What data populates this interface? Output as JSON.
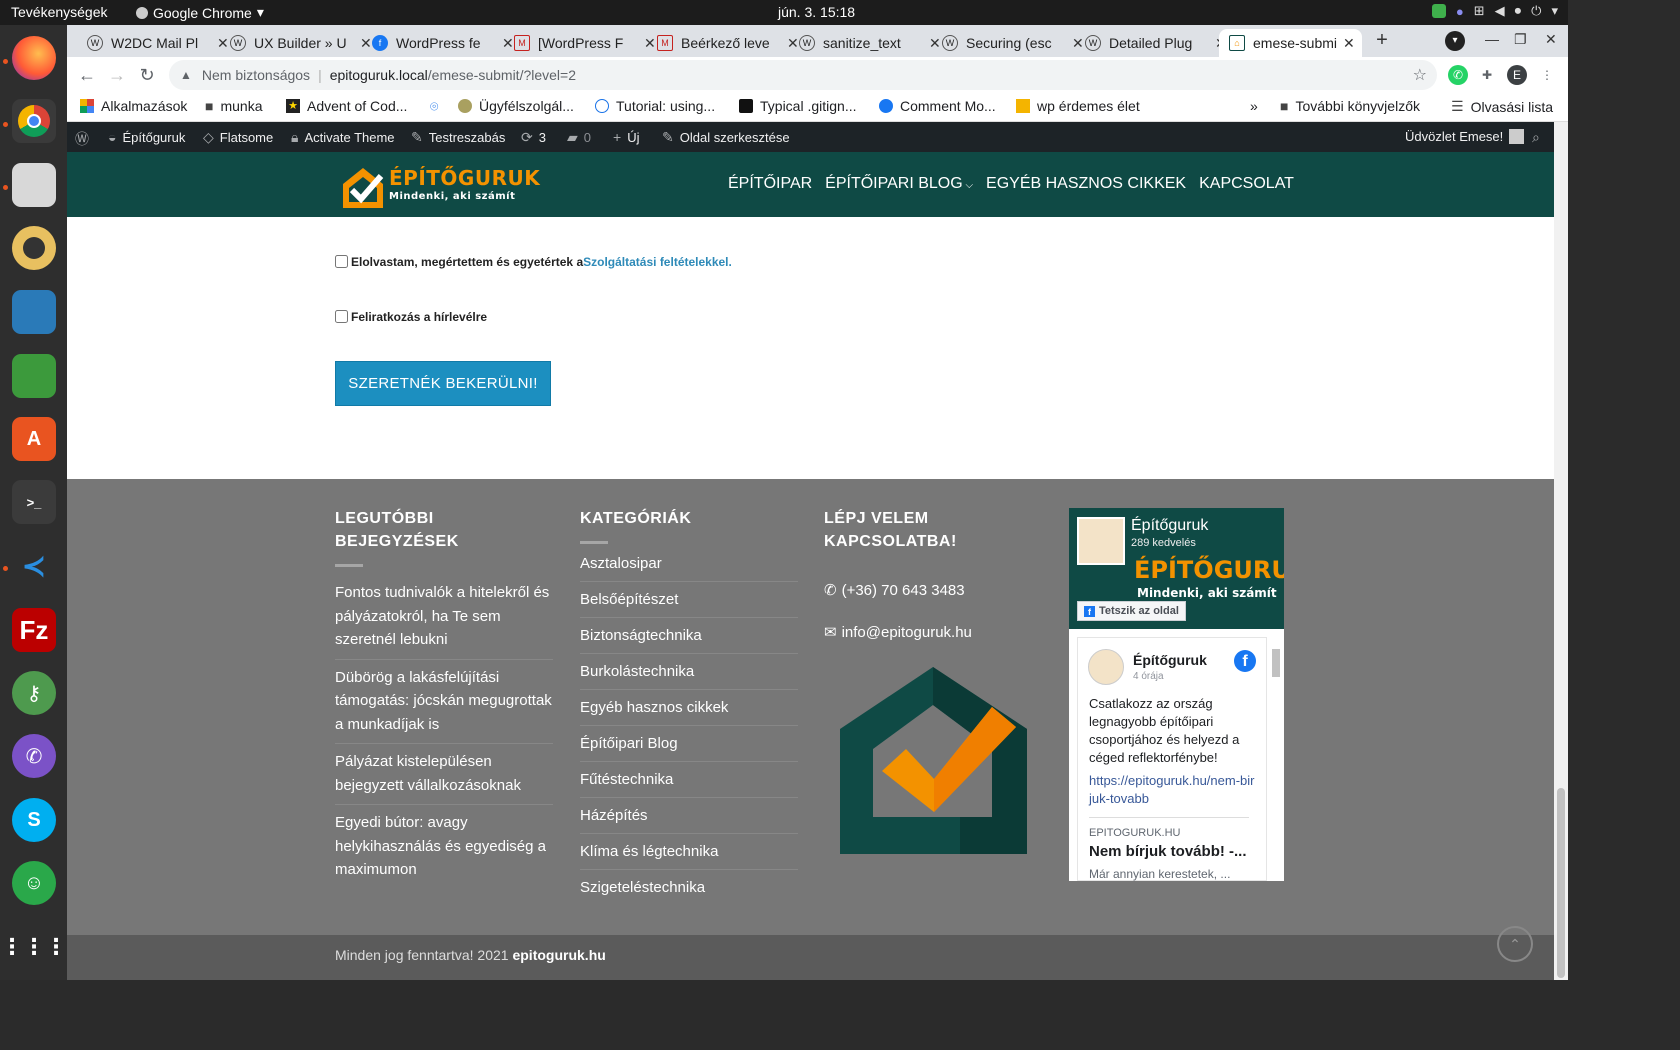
{
  "topbar": {
    "activities": "Tevékenységek",
    "app_name": "Google Chrome",
    "clock": "jún. 3.  15:18"
  },
  "dock": {
    "apps": [
      "firefox-icon",
      "chrome-icon",
      "files-icon",
      "rhythmbox-icon",
      "writer-icon",
      "calc-icon",
      "software-icon",
      "terminal-icon",
      "vscode-icon",
      "filezilla-icon",
      "keepass-icon",
      "viber-icon",
      "skype-icon",
      "linux-app-icon",
      "show-apps-icon"
    ]
  },
  "tabs": [
    {
      "title": "W2DC Mail Pl",
      "favicon": "wordpress-icon"
    },
    {
      "title": "UX Builder » U",
      "favicon": "wordpress-icon"
    },
    {
      "title": "WordPress fe",
      "favicon": "facebook-icon"
    },
    {
      "title": "[WordPress F",
      "favicon": "gmail-icon"
    },
    {
      "title": "Beérkező leve",
      "favicon": "gmail-icon"
    },
    {
      "title": "sanitize_text",
      "favicon": "wordpress-icon"
    },
    {
      "title": "Securing (esc",
      "favicon": "wordpress-icon"
    },
    {
      "title": "Detailed Plug",
      "favicon": "wordpress-icon"
    },
    {
      "title": "emese-submi",
      "favicon": "house-icon"
    }
  ],
  "omnibox": {
    "security_label": "Nem biztonságos",
    "host": "epitoguruk.local",
    "path": "/emese-submit/?level=2"
  },
  "bookmarks": {
    "items": [
      "Alkalmazások",
      "munka",
      "Advent of Cod...",
      "",
      "Ügyfélszolgál...",
      "Tutorial: using...",
      "Typical .gitign...",
      "Comment Mo...",
      "wp érdemes élet"
    ],
    "more": "»",
    "other_folder": "További könyvjelzők",
    "reading_list": "Olvasási lista"
  },
  "wpbar": {
    "site": "Építőguruk",
    "theme": "Flatsome",
    "activate": "Activate Theme",
    "customize": "Testreszabás",
    "updates": "3",
    "comments": "0",
    "new": "Új",
    "edit": "Oldal szerkesztése",
    "greeting": "Üdvözlet Emese!"
  },
  "header": {
    "logo_main": "ÉPÍTŐGURUK",
    "logo_sub": "Mindenki, aki számít",
    "nav": [
      "ÉPÍTŐIPAR",
      "ÉPÍTŐIPARI BLOG",
      "EGYÉB HASZNOS CIKKEK",
      "KAPCSOLAT"
    ]
  },
  "form": {
    "terms_text": "Elolvastam, megértettem és egyetértek a",
    "terms_link": "Szolgáltatási feltételekkel.",
    "newsletter": "Feliratkozás a hírlevélre",
    "submit": "SZERETNÉK BEKERÜLNI!"
  },
  "footer": {
    "recent_title": "LEGUTÓBBI BEJEGYZÉSEK",
    "recent_posts": [
      "Fontos tudnivalók a hitelekről és pályázatokról, ha Te sem szeretnél lebukni",
      "Dübörög a lakásfelújítási támogatás: jócskán megugrottak a munkadíjak is",
      "Pályázat kistelepülésen bejegyzett vállalkozásoknak",
      "Egyedi bútor: avagy helykihasználás és egyediség a maximumon"
    ],
    "categories_title": "KATEGÓRIÁK",
    "categories": [
      "Asztalosipar",
      "Belsőépítészet",
      "Biztonságtechnika",
      "Burkolástechnika",
      "Egyéb hasznos cikkek",
      "Építőipari Blog",
      "Fűtéstechnika",
      "Házépítés",
      "Klíma és légtechnika",
      "Szigeteléstechnika"
    ],
    "contact_title": "LÉPJ VELEM KAPCSOLATBA!",
    "phone": "(+36) 70 643 3483",
    "email": "info@epitoguruk.hu",
    "copyright_prefix": "Minden jog fenntartva! 2021",
    "copyright_site": "epitoguruk.hu"
  },
  "fb": {
    "page_name": "Építőguruk",
    "likes": "289 kedvelés",
    "brand": "ÉPÍTŐGURUK",
    "brand_sub": "Mindenki, aki számít",
    "like_button": "Tetszik az oldal",
    "post_author": "Építőguruk",
    "post_time": "4 órája",
    "post_text": "Csatlakozz az ország legnagyobb építőipari csoportjához és helyezd a céged reflektorfénybe!",
    "post_link": "https://epitoguruk.hu/nem-birjuk-tovabb",
    "link_source": "EPITOGURUK.HU",
    "link_title": "Nem bírjuk tovább! -...",
    "link_desc": "Már annyian kerestetek, ..."
  }
}
